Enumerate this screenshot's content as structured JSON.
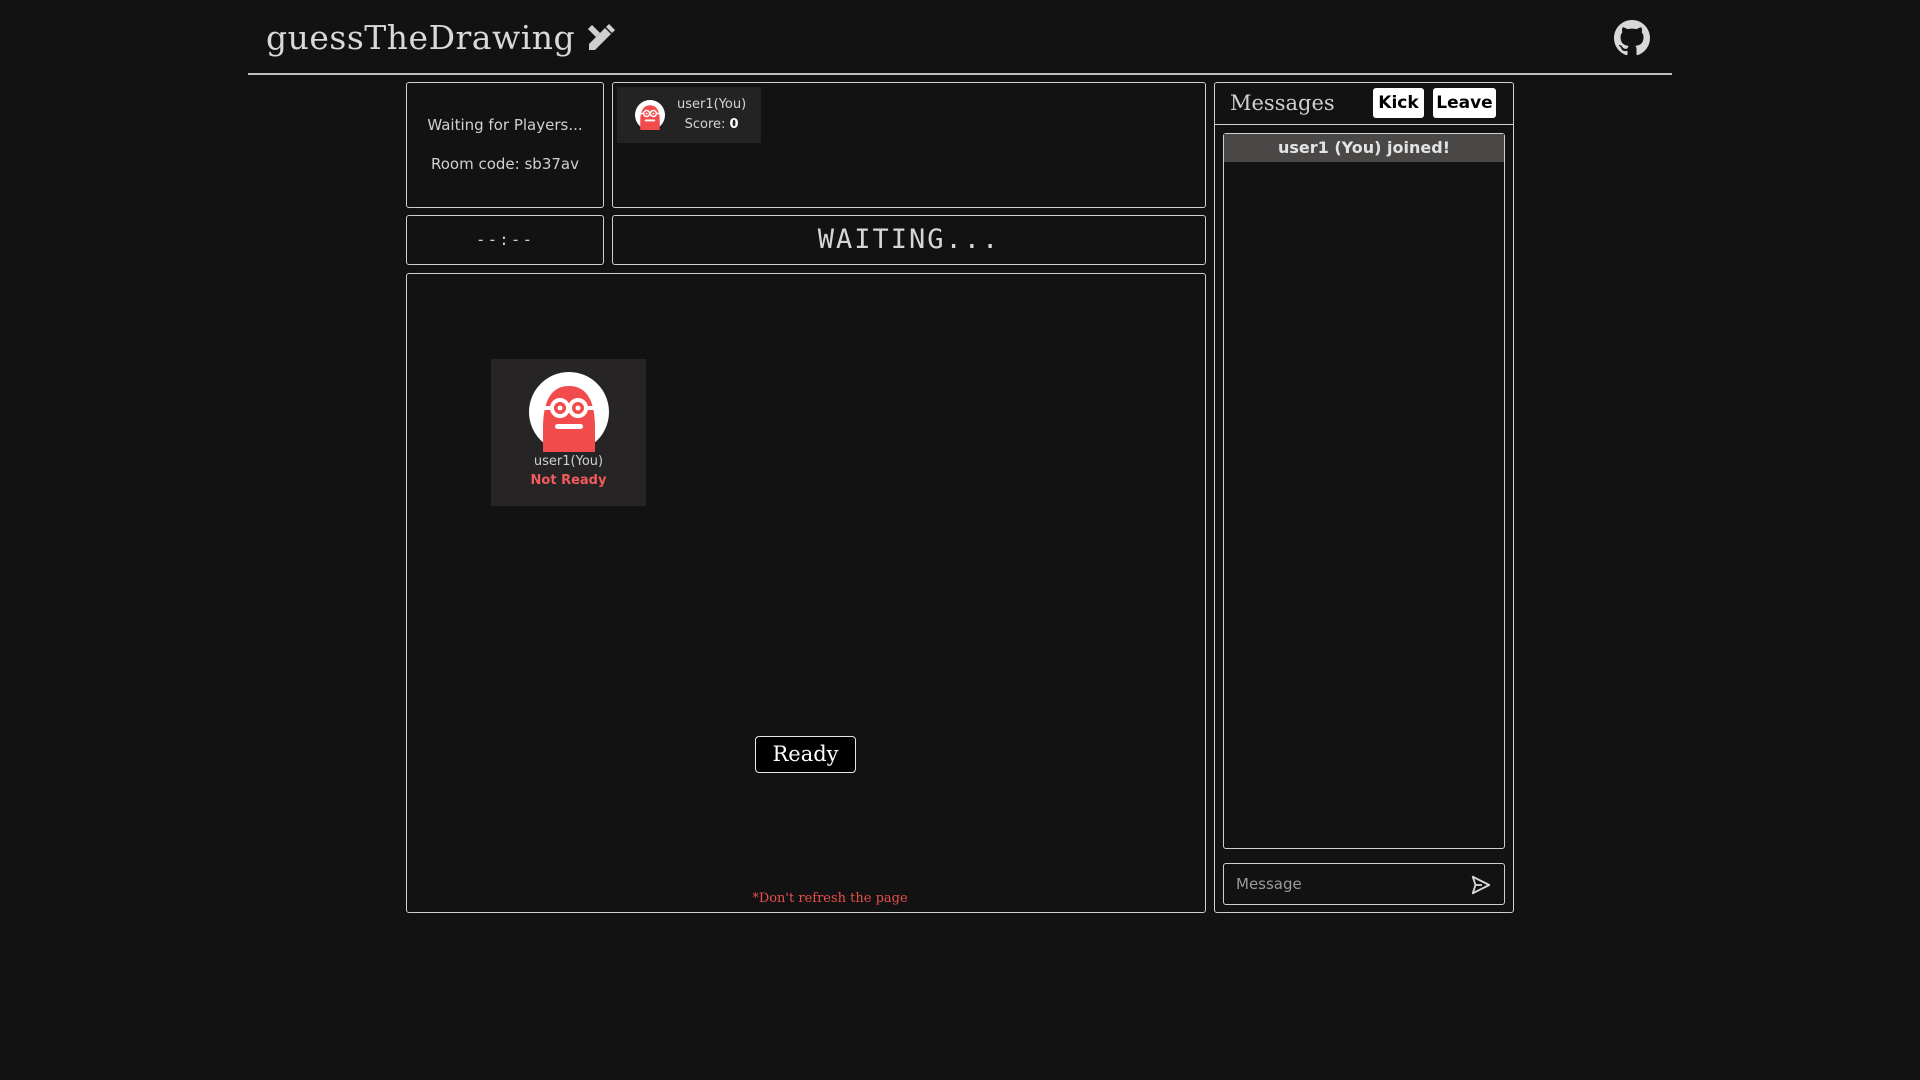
{
  "app": {
    "brand": "guessTheDrawing",
    "icons": {
      "brand": "pencil-ruler-icon",
      "repo": "github-icon"
    }
  },
  "room": {
    "status_text": "Waiting for Players...",
    "room_code": "Room code: sb37av"
  },
  "players": [
    {
      "name": "user1(You)",
      "score_label": "Score: ",
      "score": "0",
      "ready_status": "Not Ready"
    }
  ],
  "timer": "--:--",
  "game_status": "WAITING...",
  "canvas": {
    "ready_button": "Ready",
    "warning": "*Don't refresh the page"
  },
  "messages": {
    "title": "Messages",
    "kick_label": "Kick",
    "leave_label": "Leave",
    "items": [
      {
        "text": "user1 (You) joined!"
      }
    ],
    "input_placeholder": "Message",
    "send_icon": "send-icon"
  },
  "colors": {
    "background": "#121212",
    "avatar": "#f24b4b",
    "not_ready": "#f15b5b",
    "warning": "#e8504c"
  }
}
